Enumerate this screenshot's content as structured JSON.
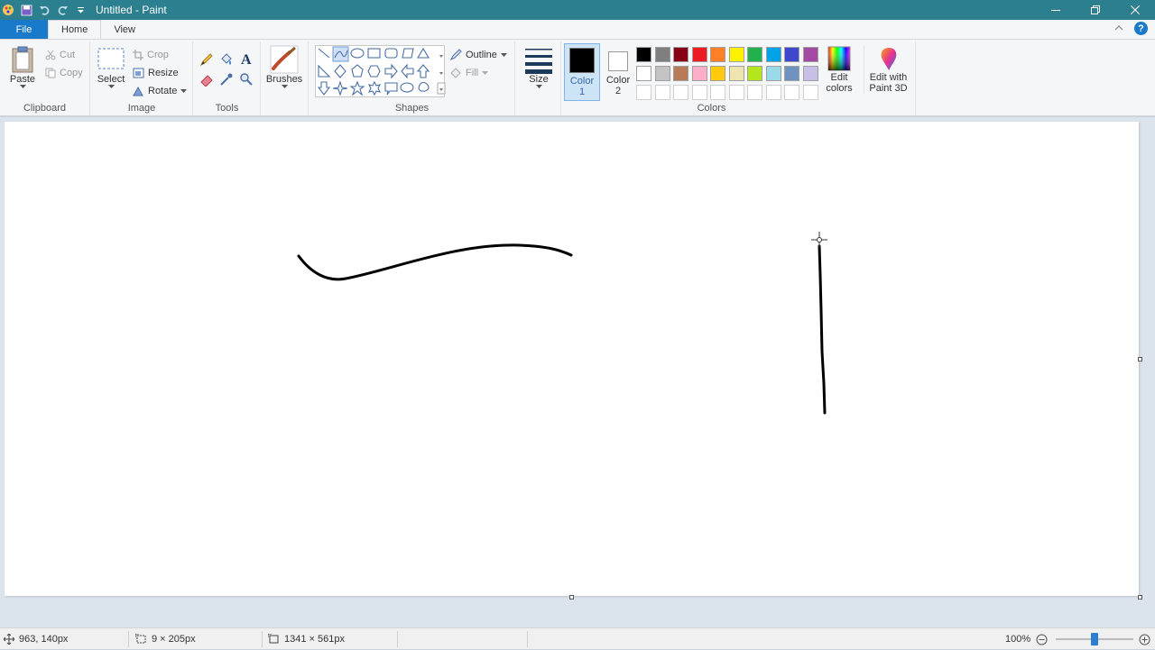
{
  "window": {
    "title": "Untitled - Paint"
  },
  "tabs": {
    "file": "File",
    "home": "Home",
    "view": "View"
  },
  "clipboard": {
    "label": "Clipboard",
    "paste": "Paste",
    "cut": "Cut",
    "copy": "Copy"
  },
  "image": {
    "label": "Image",
    "select": "Select",
    "crop": "Crop",
    "resize": "Resize",
    "rotate": "Rotate"
  },
  "tools": {
    "label": "Tools"
  },
  "brushes": {
    "label": "Brushes"
  },
  "shapes": {
    "label": "Shapes",
    "outline": "Outline",
    "fill": "Fill"
  },
  "size": {
    "label": "Size"
  },
  "colors": {
    "label": "Colors",
    "color1": "Color 1",
    "color2": "Color 2",
    "edit_colors": "Edit colors",
    "edit_paint3d": "Edit with Paint 3D",
    "color1_value": "#000000",
    "color2_value": "#ffffff",
    "palette_row1": [
      "#000000",
      "#7f7f7f",
      "#880015",
      "#ed1c24",
      "#ff7f27",
      "#fff200",
      "#22b14c",
      "#00a2e8",
      "#3f48cc",
      "#a349a4"
    ],
    "palette_row2": [
      "#ffffff",
      "#c3c3c3",
      "#b97a57",
      "#ffaec9",
      "#ffc90e",
      "#efe4b0",
      "#b5e61d",
      "#99d9ea",
      "#7092be",
      "#c8bfe7"
    ]
  },
  "status": {
    "cursor_pos": "963, 140px",
    "selection_size": "9 × 205px",
    "canvas_size": "1341 × 561px",
    "zoom": "100%",
    "zoom_fraction": 0.5
  }
}
